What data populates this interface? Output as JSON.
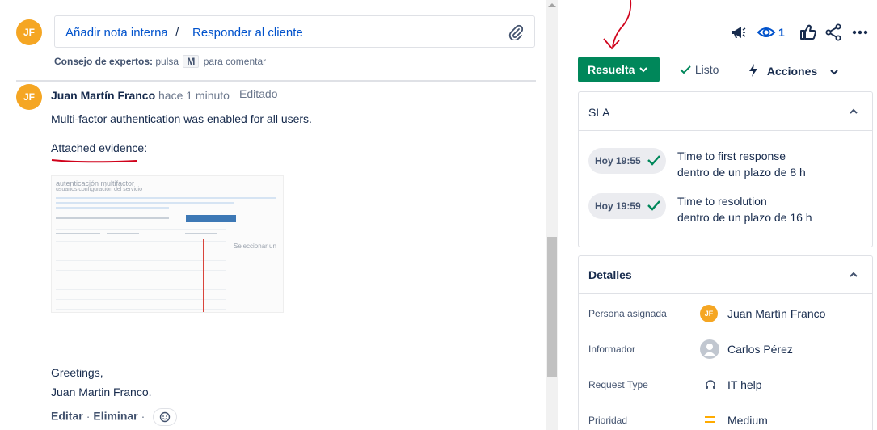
{
  "composer": {
    "avatar_initials": "JF",
    "add_note_label": "Añadir nota interna",
    "separator": "/",
    "reply_label": "Responder al cliente",
    "tip_prefix": "Consejo de expertos:",
    "tip_press": "pulsa",
    "tip_key": "M",
    "tip_suffix": "para comentar"
  },
  "comment": {
    "avatar_initials": "JF",
    "author": "Juan Martín Franco",
    "time": "hace 1 minuto",
    "edited": "Editado",
    "line1": "Multi-factor authentication was enabled for all users.",
    "line2": "Attached evidence:",
    "screenshot": {
      "title": "autenticación multifactor",
      "subtitle": "usuarios    configuración del servicio",
      "side_text": "Seleccionar un ..."
    },
    "greeting1": "Greetings,",
    "greeting2": "Juan Martin Franco.",
    "edit_label": "Editar",
    "delete_label": "Eliminar",
    "dot": "·"
  },
  "header": {
    "watch_count": "1",
    "status_label": "Resuelta",
    "done_label": "Listo",
    "actions_label": "Acciones"
  },
  "sla": {
    "title": "SLA",
    "items": [
      {
        "pill": "Hoy 19:55",
        "name": "Time to first response",
        "detail": "dentro de un plazo de 8 h"
      },
      {
        "pill": "Hoy 19:59",
        "name": "Time to resolution",
        "detail": "dentro de un plazo de 16 h"
      }
    ]
  },
  "details": {
    "title": "Detalles",
    "assignee_label": "Persona asignada",
    "assignee_initials": "JF",
    "assignee": "Juan Martín Franco",
    "reporter_label": "Informador",
    "reporter": "Carlos Pérez",
    "request_type_label": "Request Type",
    "request_type": "IT help",
    "priority_label": "Prioridad",
    "priority": "Medium"
  },
  "colors": {
    "status_green": "#00875a",
    "link_blue": "#0052cc",
    "avatar_orange": "#f5a623",
    "annotation_red": "#d0021b",
    "priority_orange": "#ffab00"
  }
}
